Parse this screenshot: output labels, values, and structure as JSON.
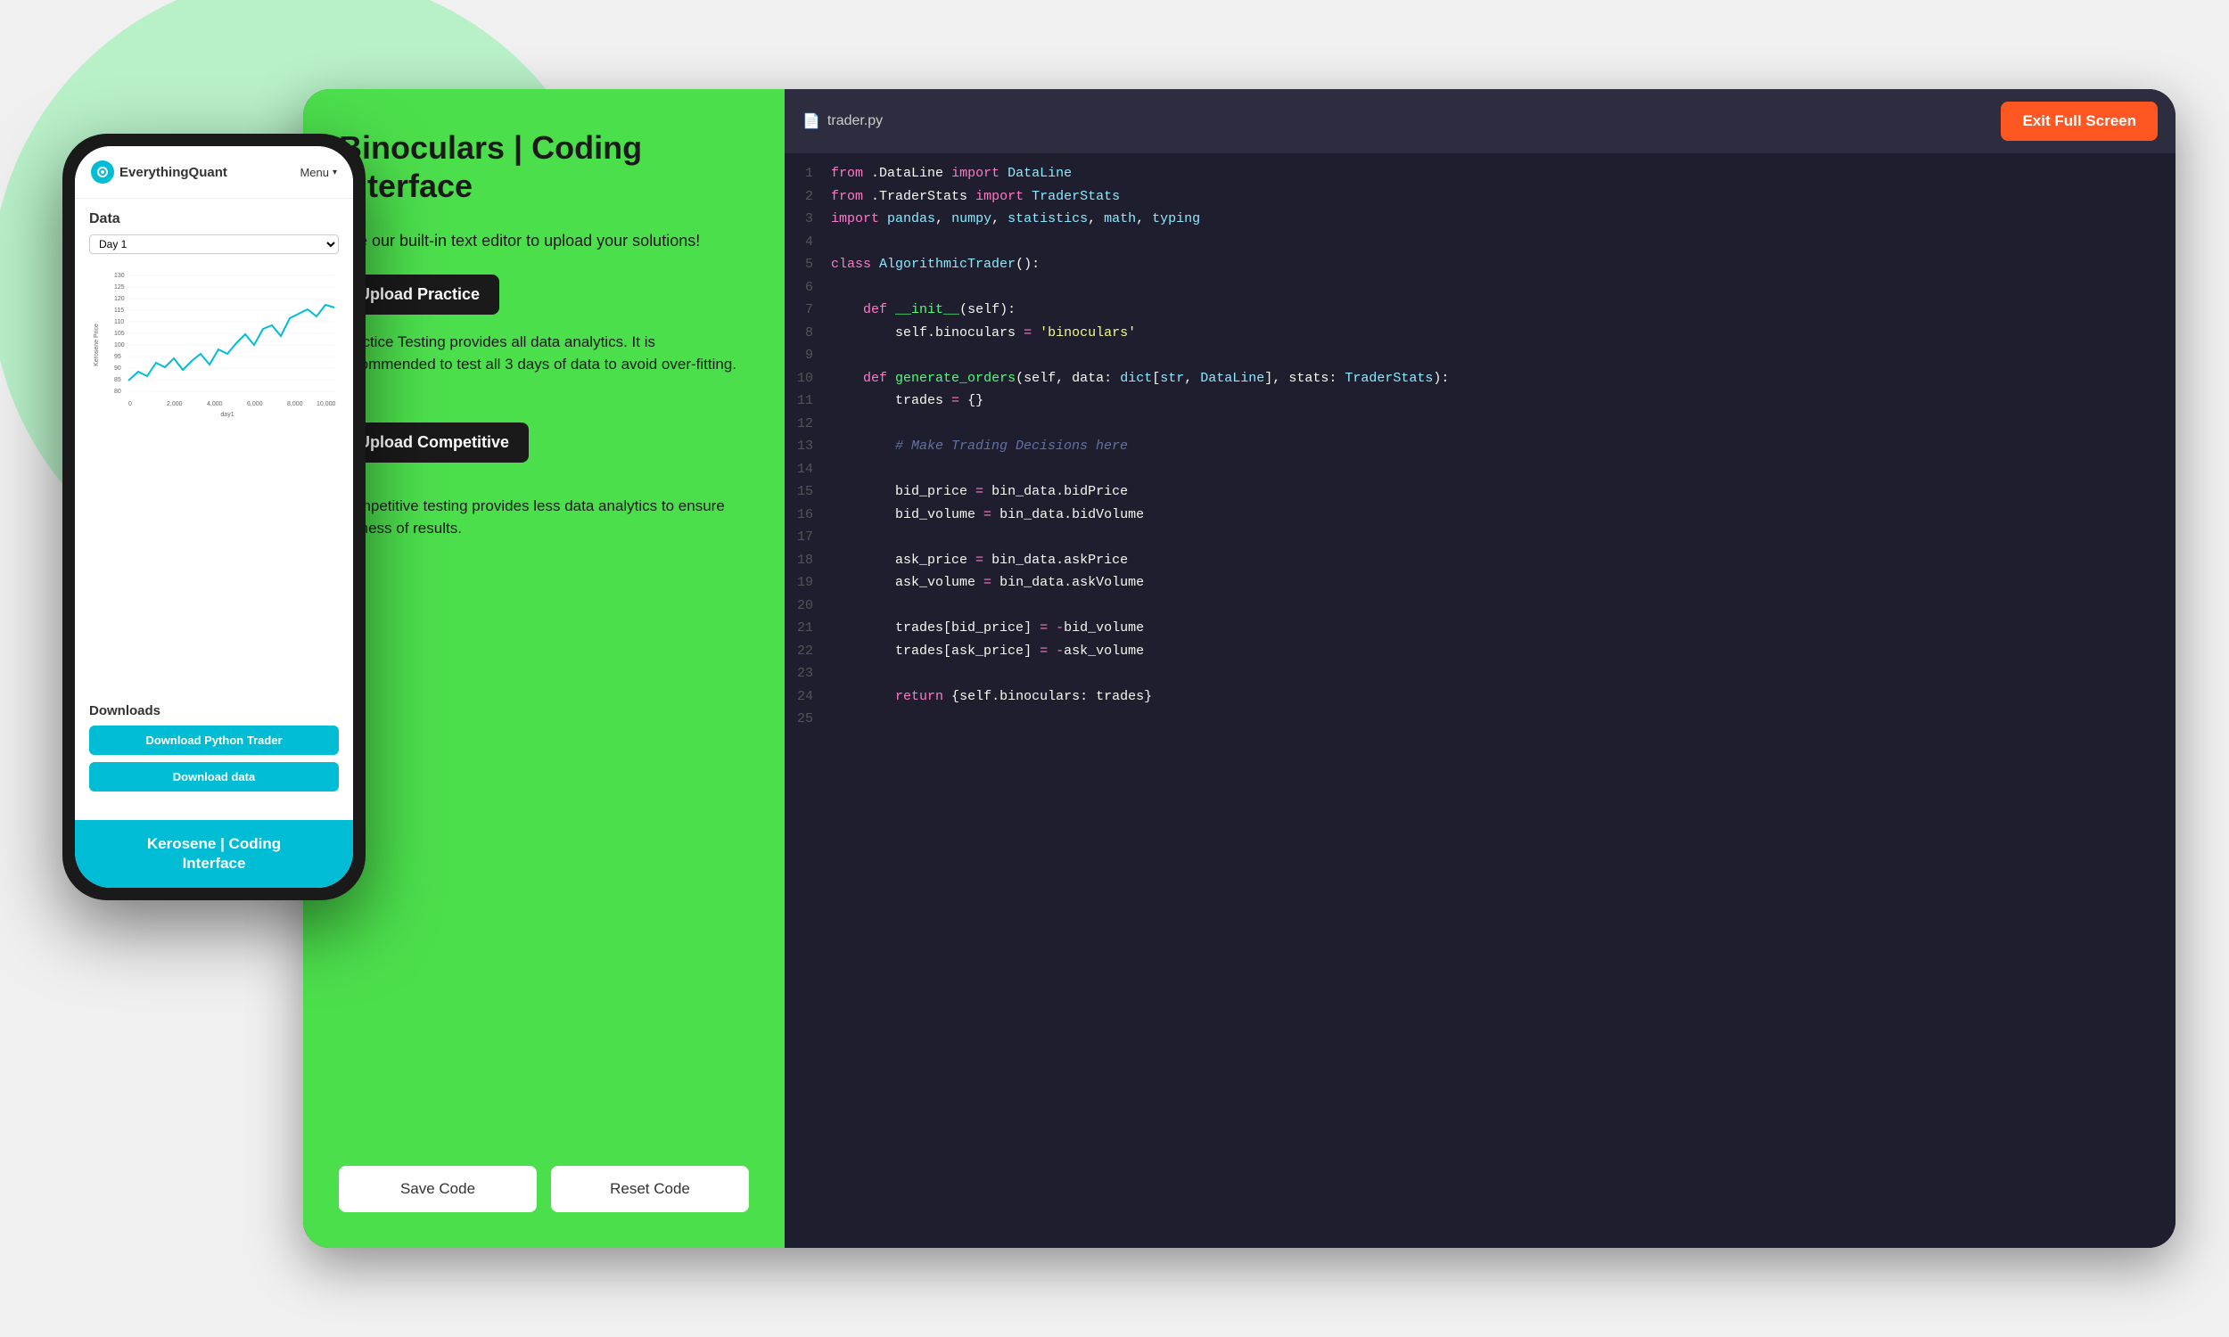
{
  "scene": {
    "bg_circle_color": "#b8f0c8"
  },
  "phone": {
    "nav": {
      "logo_text_1": "Everything",
      "logo_text_2": "Quant",
      "menu_label": "Menu"
    },
    "data_section": {
      "title": "Data",
      "day_select": "Day 1"
    },
    "chart": {
      "y_label": "Kerosene Price",
      "x_label": "day1",
      "y_ticks": [
        "130",
        "125",
        "120",
        "115",
        "110",
        "105",
        "100",
        "95",
        "90",
        "85",
        "80"
      ],
      "x_ticks": [
        "0",
        "2,000",
        "4,000",
        "6,000",
        "8,000",
        "10,000"
      ]
    },
    "downloads": {
      "title": "Downloads",
      "btn1_label": "Download Python Trader",
      "btn2_label": "Download data"
    },
    "bottom_bar": {
      "text": "Kerosene | Coding\nInterface"
    }
  },
  "green_panel": {
    "title": "Binoculars | Coding Interface",
    "intro_text": "Use our built-in text editor to upload your solutions!",
    "upload_practice_label": "Upload Practice",
    "practice_desc": "Practice Testing provides all data analytics. It is recommended to test all 3 days of data to avoid over-fitting.",
    "upload_competitive_label": "Upload Competitive",
    "competitive_desc": "Competitive testing provides less data analytics to ensure fairness of results.",
    "save_code_label": "Save Code",
    "reset_code_label": "Reset Code"
  },
  "code_panel": {
    "file_name": "trader.py",
    "exit_fullscreen_label": "Exit Full Screen",
    "lines": [
      {
        "num": 1,
        "code": "from .DataLine import DataLine"
      },
      {
        "num": 2,
        "code": "from .TraderStats import TraderStats"
      },
      {
        "num": 3,
        "code": "import pandas, numpy, statistics, math, typing"
      },
      {
        "num": 4,
        "code": ""
      },
      {
        "num": 5,
        "code": "class AlgorithmicTrader():"
      },
      {
        "num": 6,
        "code": ""
      },
      {
        "num": 7,
        "code": "    def __init__(self):"
      },
      {
        "num": 8,
        "code": "        self.binoculars = 'binoculars'"
      },
      {
        "num": 9,
        "code": ""
      },
      {
        "num": 10,
        "code": "    def generate_orders(self, data: dict[str, DataLine], stats: TraderStats):"
      },
      {
        "num": 11,
        "code": "        trades = {}"
      },
      {
        "num": 12,
        "code": ""
      },
      {
        "num": 13,
        "code": "        # Make Trading Decisions here"
      },
      {
        "num": 14,
        "code": ""
      },
      {
        "num": 15,
        "code": "        bid_price = bin_data.bidPrice"
      },
      {
        "num": 16,
        "code": "        bid_volume = bin_data.bidVolume"
      },
      {
        "num": 17,
        "code": ""
      },
      {
        "num": 18,
        "code": "        ask_price = bin_data.askPrice"
      },
      {
        "num": 19,
        "code": "        ask_volume = bin_data.askVolume"
      },
      {
        "num": 20,
        "code": ""
      },
      {
        "num": 21,
        "code": "        trades[bid_price] = -bid_volume"
      },
      {
        "num": 22,
        "code": "        trades[ask_price] = -ask_volume"
      },
      {
        "num": 23,
        "code": ""
      },
      {
        "num": 24,
        "code": "        return {self.binoculars: trades}"
      },
      {
        "num": 25,
        "code": ""
      }
    ]
  }
}
